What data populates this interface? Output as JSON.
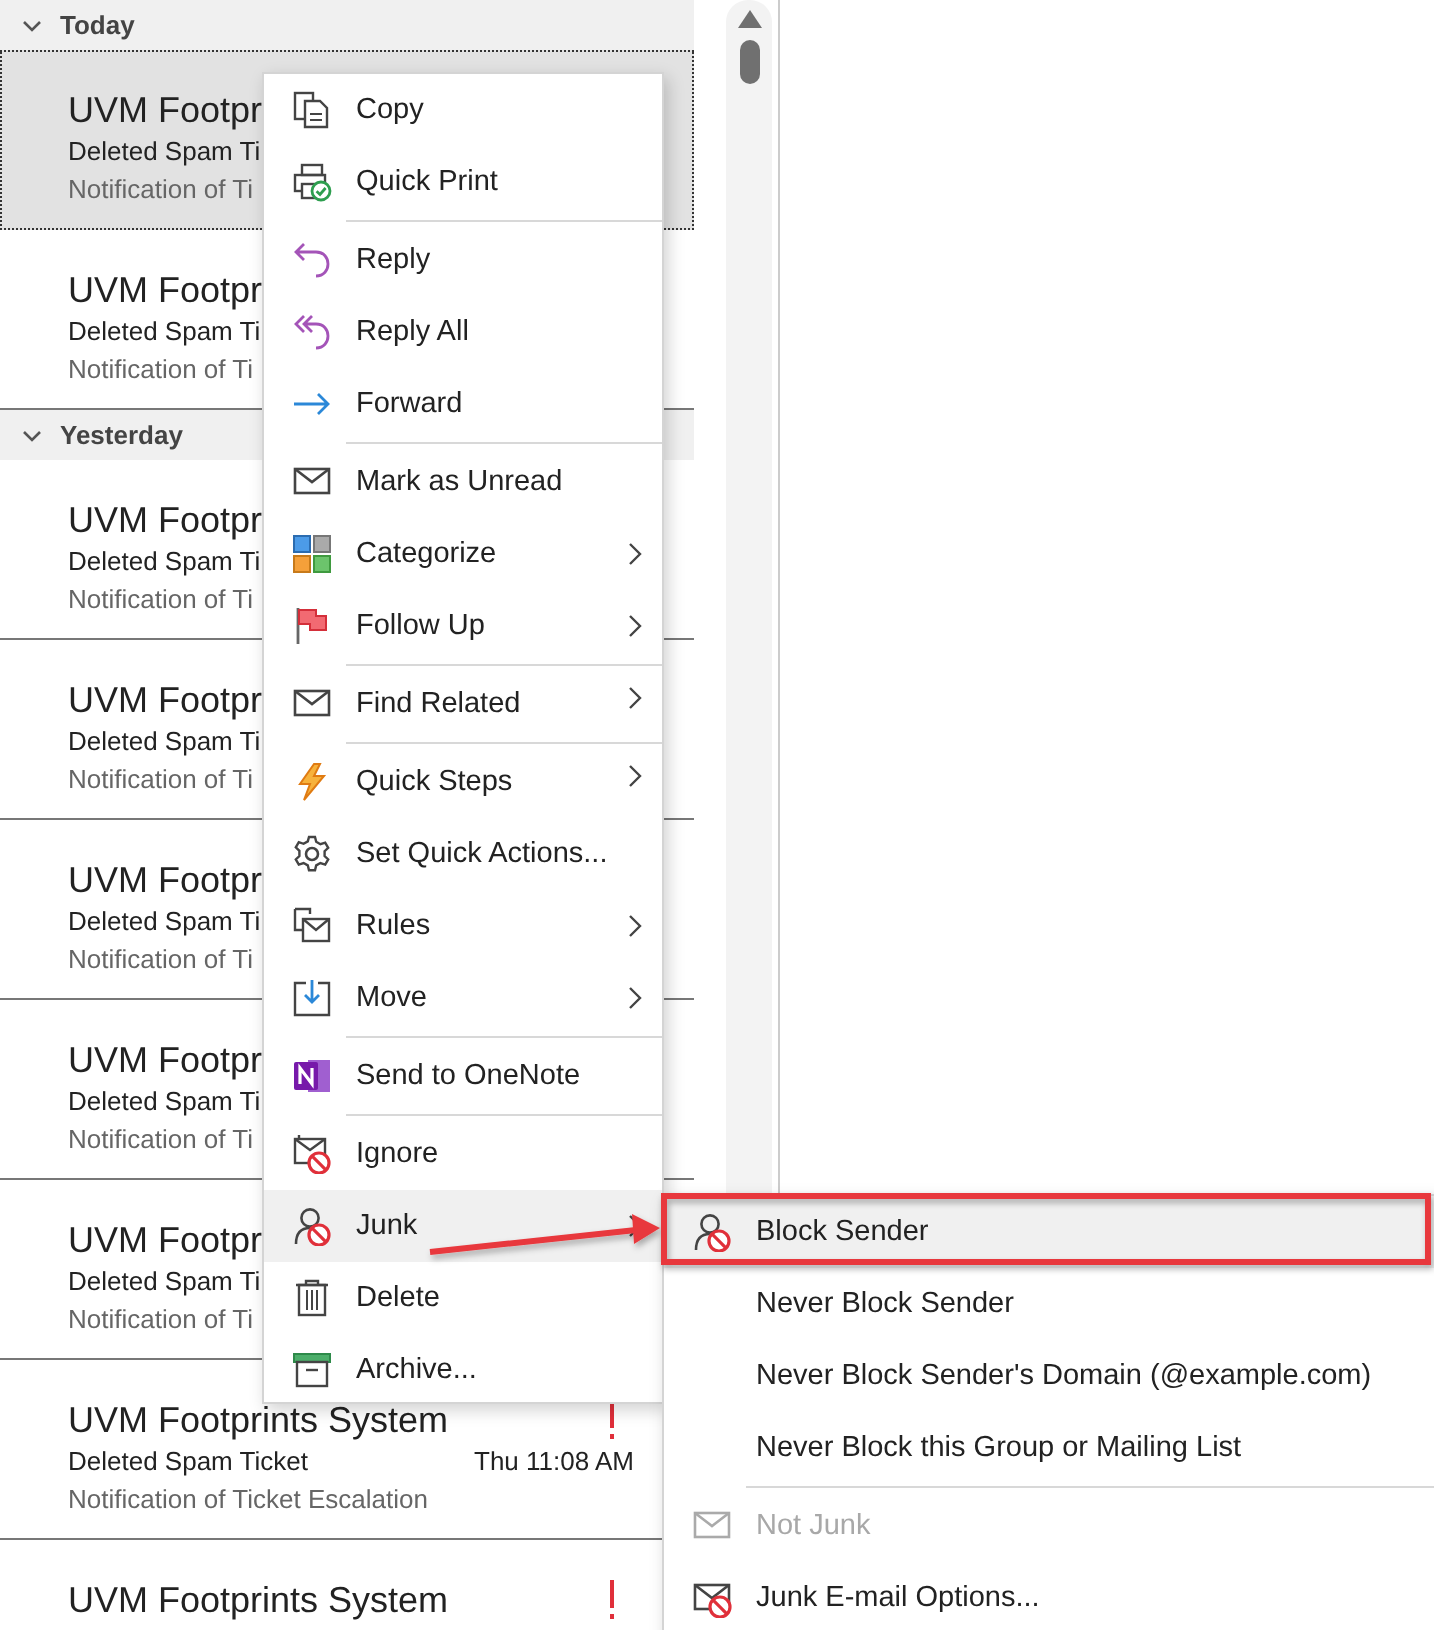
{
  "message_list": {
    "groups": [
      {
        "label": "Today",
        "expanded": true,
        "messages": [
          {
            "sender": "UVM Footpr",
            "subject": "Deleted Spam Ti",
            "preview": "Notification of Ti",
            "selected": true
          },
          {
            "sender": "UVM Footpr",
            "subject": "Deleted Spam Ti",
            "preview": "Notification of Ti",
            "selected": false
          }
        ]
      },
      {
        "label": "Yesterday",
        "expanded": true,
        "messages": [
          {
            "sender": "UVM Footpr",
            "subject": "Deleted Spam Ti",
            "preview": "Notification of Ti",
            "selected": false
          },
          {
            "sender": "UVM Footpr",
            "subject": "Deleted Spam Ti",
            "preview": "Notification of Ti",
            "selected": false
          },
          {
            "sender": "UVM Footpr",
            "subject": "Deleted Spam Ti",
            "preview": "Notification of Ti",
            "selected": false
          },
          {
            "sender": "UVM Footpr",
            "subject": "Deleted Spam Ti",
            "preview": "Notification of Ti",
            "selected": false
          },
          {
            "sender": "UVM Footpr",
            "subject": "Deleted Spam Ti",
            "preview": "Notification of Ti",
            "selected": false
          },
          {
            "sender": "UVM Footprints System",
            "subject": "Deleted Spam Ticket",
            "time": "Thu 11:08 AM",
            "preview": "Notification of Ticket Escalation",
            "selected": false,
            "important": true
          },
          {
            "sender": "UVM Footprints System",
            "selected": false,
            "important": true
          }
        ]
      }
    ]
  },
  "context_menu": {
    "items": [
      {
        "label": "Copy",
        "separator_before": false,
        "submenu": false,
        "selected": false
      },
      {
        "label": "Quick Print",
        "separator_before": false,
        "submenu": false,
        "selected": false
      },
      {
        "label": "Reply",
        "separator_before": true,
        "submenu": false,
        "selected": false
      },
      {
        "label": "Reply All",
        "separator_before": false,
        "submenu": false,
        "selected": false
      },
      {
        "label": "Forward",
        "separator_before": false,
        "submenu": false,
        "selected": false
      },
      {
        "label": "Mark as Unread",
        "separator_before": true,
        "submenu": false,
        "selected": false
      },
      {
        "label": "Categorize",
        "separator_before": false,
        "submenu": true,
        "selected": false
      },
      {
        "label": "Follow Up",
        "separator_before": false,
        "submenu": true,
        "selected": false
      },
      {
        "label": "Find Related",
        "separator_before": true,
        "submenu": true,
        "selected": false
      },
      {
        "label": "Quick Steps",
        "separator_before": true,
        "submenu": true,
        "selected": false
      },
      {
        "label": "Set Quick Actions...",
        "separator_before": false,
        "submenu": false,
        "selected": false
      },
      {
        "label": "Rules",
        "separator_before": false,
        "submenu": true,
        "selected": false
      },
      {
        "label": "Move",
        "separator_before": false,
        "submenu": true,
        "selected": false
      },
      {
        "label": "Send to OneNote",
        "separator_before": true,
        "submenu": false,
        "selected": false
      },
      {
        "label": "Ignore",
        "separator_before": true,
        "submenu": false,
        "selected": false
      },
      {
        "label": "Junk",
        "separator_before": false,
        "submenu": true,
        "selected": true
      },
      {
        "label": "Delete",
        "separator_before": false,
        "submenu": false,
        "selected": false
      },
      {
        "label": "Archive...",
        "separator_before": false,
        "submenu": false,
        "selected": false
      }
    ]
  },
  "junk_submenu": {
    "items": [
      {
        "label": "Block Sender",
        "separator_before": false,
        "selected": true,
        "disabled": false
      },
      {
        "label": "Never Block Sender",
        "separator_before": false,
        "selected": false,
        "disabled": false
      },
      {
        "label": "Never Block Sender's Domain (@example.com)",
        "separator_before": false,
        "selected": false,
        "disabled": false
      },
      {
        "label": "Never Block this Group or Mailing List",
        "separator_before": false,
        "selected": false,
        "disabled": false
      },
      {
        "label": "Not Junk",
        "separator_before": true,
        "selected": false,
        "disabled": true
      },
      {
        "label": "Junk E-mail Options...",
        "separator_before": false,
        "selected": false,
        "disabled": false
      }
    ]
  }
}
